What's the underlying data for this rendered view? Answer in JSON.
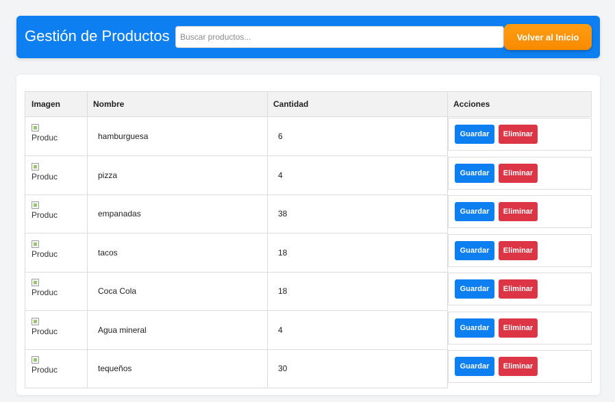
{
  "header": {
    "title": "Gestión de Productos",
    "search_placeholder": "Buscar productos...",
    "back_button_label": "Volver al Inicio"
  },
  "table": {
    "columns": [
      "Imagen",
      "Nombre",
      "Cantidad",
      "Acciones"
    ],
    "rows": [
      {
        "image_alt": "Produc",
        "name": "hamburguesa",
        "quantity": "6"
      },
      {
        "image_alt": "Produc",
        "name": "pizza",
        "quantity": "4"
      },
      {
        "image_alt": "Produc",
        "name": "empanadas",
        "quantity": "38"
      },
      {
        "image_alt": "Produc",
        "name": "tacos",
        "quantity": "18"
      },
      {
        "image_alt": "Produc",
        "name": "Coca Cola",
        "quantity": "18"
      },
      {
        "image_alt": "Produc",
        "name": "Agua mineral",
        "quantity": "4"
      },
      {
        "image_alt": "Produc",
        "name": "tequeños",
        "quantity": "30"
      }
    ],
    "save_label": "Guardar",
    "delete_label": "Eliminar"
  },
  "colors": {
    "primary": "#0d7ff0",
    "accent": "#f98a00",
    "danger": "#dc3545",
    "background": "#f3f4f6"
  }
}
